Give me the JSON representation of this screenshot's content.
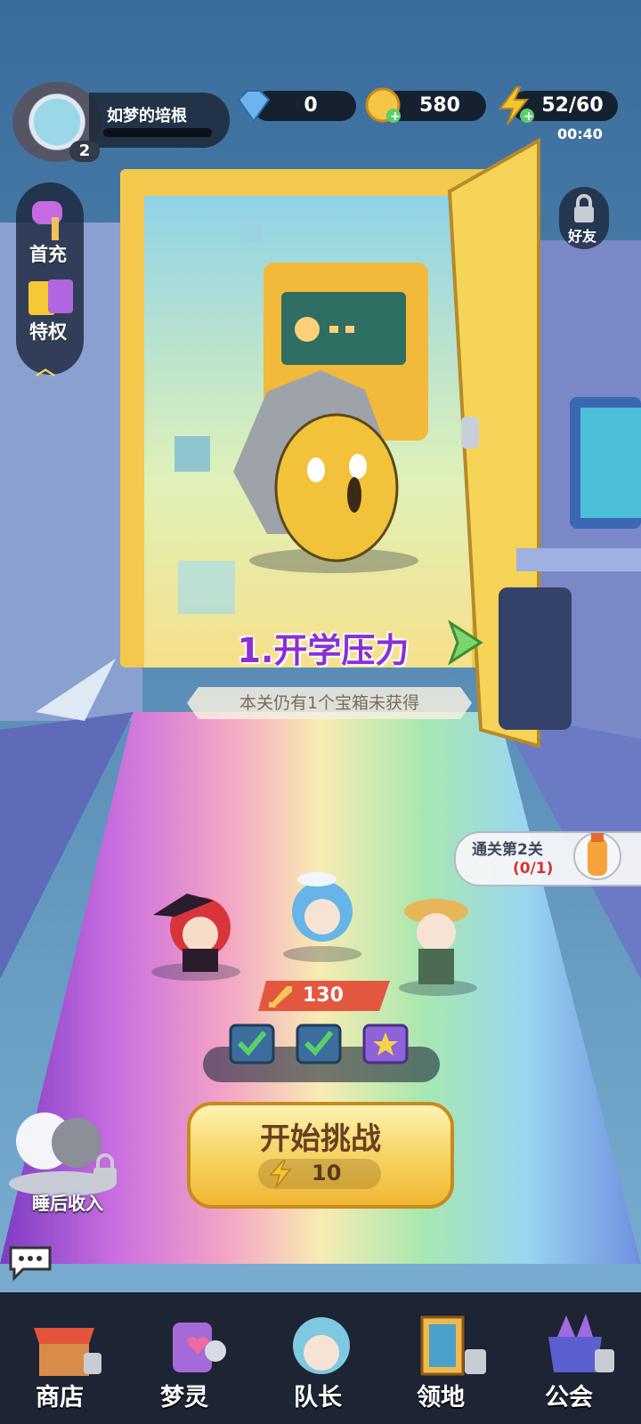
{
  "player": {
    "name": "如梦的培根",
    "level": "2"
  },
  "resources": {
    "gems": "0",
    "gold": "580",
    "energy": "52/60",
    "energy_timer": "00:40"
  },
  "side_menu": [
    {
      "label": "首充"
    },
    {
      "label": "特权"
    }
  ],
  "friends_label": "好友",
  "stage": {
    "title": "1.开学压力",
    "subtitle": "本关仍有1个宝箱未获得"
  },
  "quest": {
    "title": "通关第2关",
    "progress": "(0/1)"
  },
  "team_power": "130",
  "chests": [
    {
      "status": "claimed"
    },
    {
      "status": "claimed"
    },
    {
      "status": "unclaimed"
    }
  ],
  "start": {
    "label": "开始挑战",
    "cost": "10"
  },
  "sleep_income_label": "睡后收入",
  "nav": [
    {
      "label": "商店"
    },
    {
      "label": "梦灵"
    },
    {
      "label": "队长"
    },
    {
      "label": "领地"
    },
    {
      "label": "公会"
    }
  ],
  "colors": {
    "accent": "#8a2fd4",
    "button": "#f7d76a",
    "nav_bg": "#1d2433"
  }
}
